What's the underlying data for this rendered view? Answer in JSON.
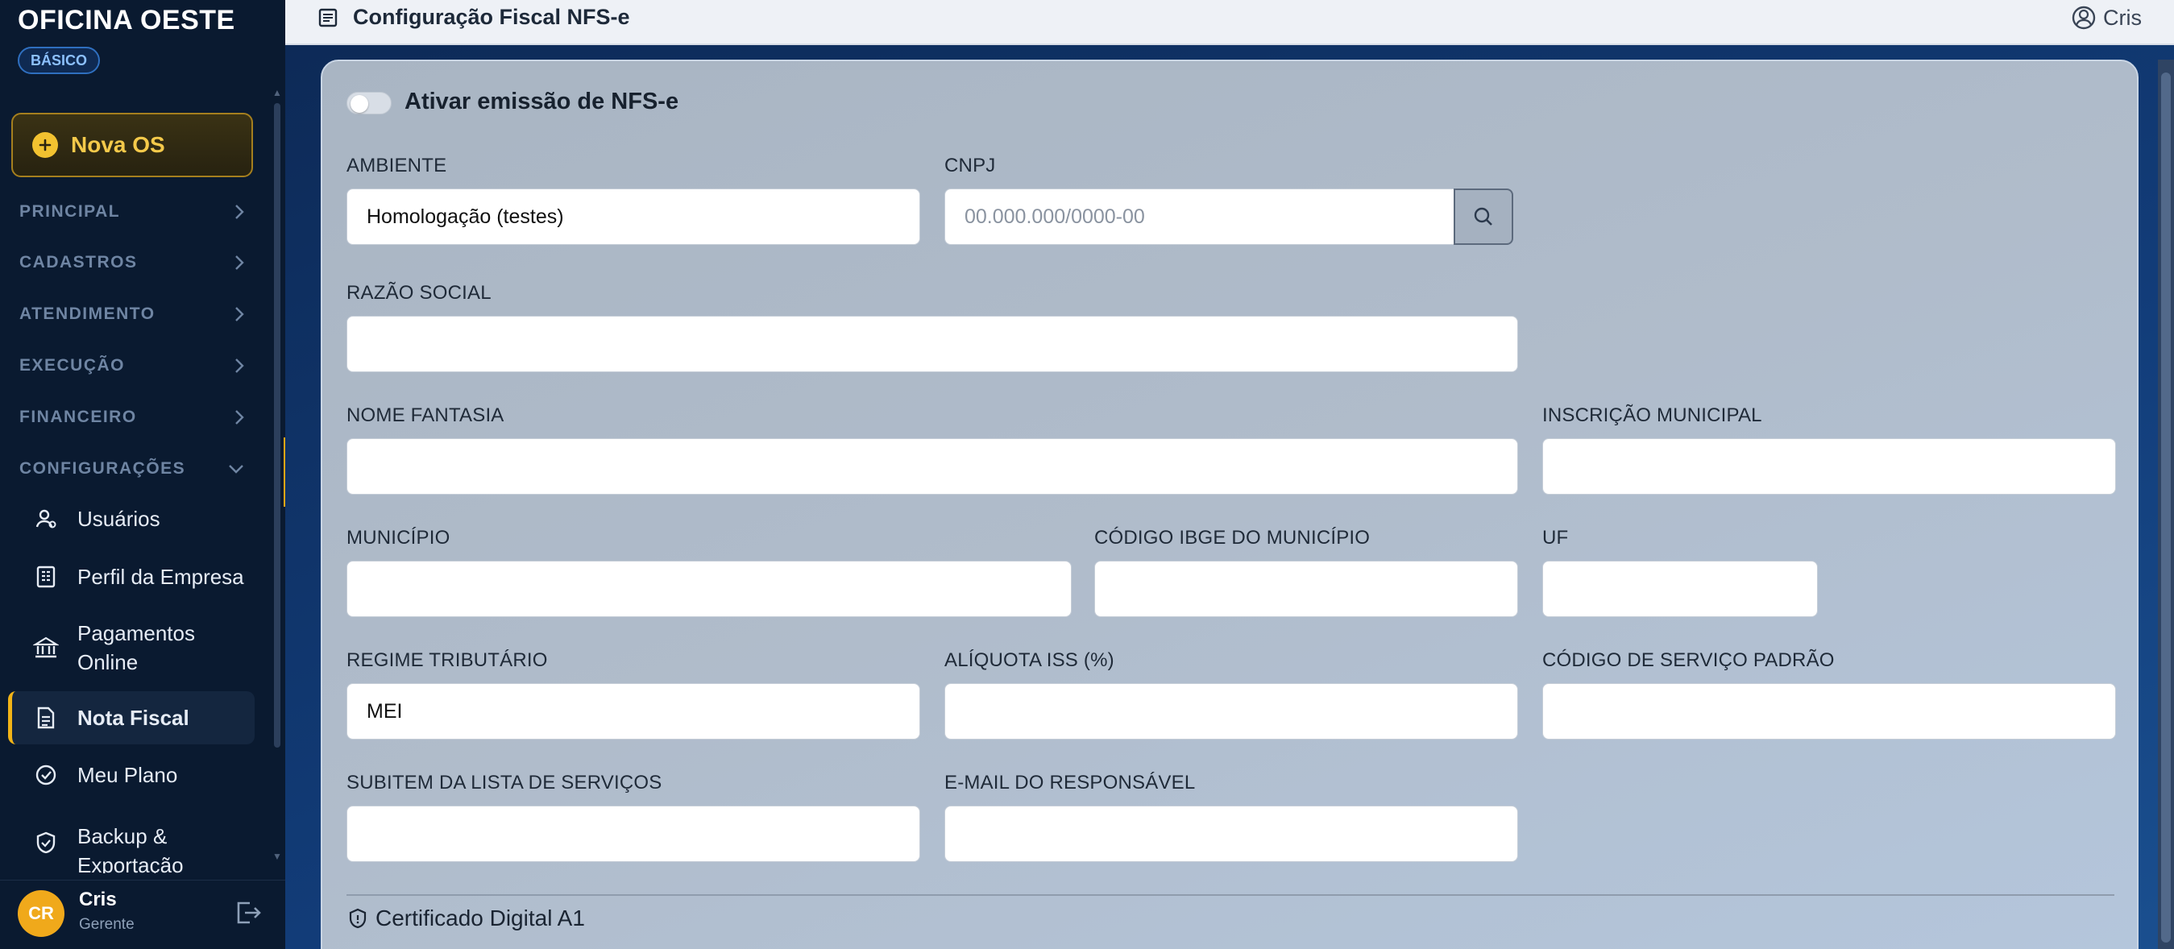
{
  "brand": {
    "name": "OFICINA OESTE",
    "plan": "BÁSICO"
  },
  "sidebar": {
    "new_os_label": "Nova OS",
    "sections": [
      {
        "label": "PRINCIPAL"
      },
      {
        "label": "CADASTROS"
      },
      {
        "label": "ATENDIMENTO"
      },
      {
        "label": "EXECUÇÃO"
      },
      {
        "label": "FINANCEIRO"
      },
      {
        "label": "CONFIGURAÇÕES"
      }
    ],
    "config_items": [
      {
        "label": "Usuários",
        "icon": "users-icon"
      },
      {
        "label": "Perfil da Empresa",
        "icon": "building-icon"
      },
      {
        "label": "Pagamentos Online",
        "icon": "bank-icon"
      },
      {
        "label": "Nota Fiscal",
        "icon": "document-icon",
        "active": true
      },
      {
        "label": "Meu Plano",
        "icon": "check-circle-icon"
      },
      {
        "label": "Backup & Exportação",
        "icon": "shield-check-icon"
      }
    ],
    "user": {
      "initials": "CR",
      "name": "Cris",
      "role": "Gerente"
    }
  },
  "topbar": {
    "title": "Configuração Fiscal NFS-e",
    "user": "Cris"
  },
  "form": {
    "toggle_label": "Ativar emissão de NFS-e",
    "ambiente": {
      "label": "AMBIENTE",
      "value": "Homologação (testes)"
    },
    "cnpj": {
      "label": "CNPJ",
      "value": "",
      "placeholder": "00.000.000/0000-00"
    },
    "razao_social": {
      "label": "RAZÃO SOCIAL",
      "value": ""
    },
    "nome_fantasia": {
      "label": "NOME FANTASIA",
      "value": ""
    },
    "inscricao_municipal": {
      "label": "INSCRIÇÃO MUNICIPAL",
      "value": ""
    },
    "municipio": {
      "label": "MUNICÍPIO",
      "value": ""
    },
    "codigo_ibge": {
      "label": "CÓDIGO IBGE DO MUNICÍPIO",
      "value": ""
    },
    "uf": {
      "label": "UF",
      "value": ""
    },
    "regime": {
      "label": "REGIME TRIBUTÁRIO",
      "value": "MEI"
    },
    "aliquota": {
      "label": "ALÍQUOTA ISS (%)",
      "value": ""
    },
    "codigo_servico": {
      "label": "CÓDIGO DE SERVIÇO PADRÃO",
      "value": ""
    },
    "subitem": {
      "label": "SUBITEM DA LISTA DE SERVIÇOS",
      "value": ""
    },
    "email": {
      "label": "E-MAIL DO RESPONSÁVEL",
      "value": ""
    },
    "certificado_title": "Certificado Digital A1"
  },
  "colors": {
    "accent": "#F2A615",
    "sidebar_bg": "#0A1A30",
    "card_bg": "#B0BCCB"
  }
}
